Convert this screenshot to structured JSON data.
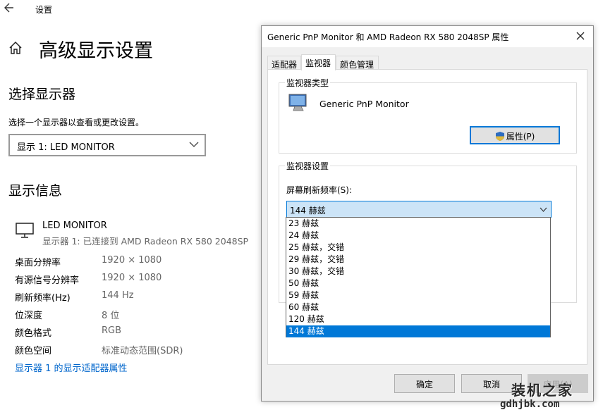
{
  "settings": {
    "app_title": "设置",
    "back_icon": "arrow-left-icon",
    "home_icon": "home-icon",
    "page_title": "高级显示设置",
    "select_section_title": "选择显示器",
    "select_description": "选择一个显示器以查看或更改设置。",
    "display_dropdown_value": "显示 1: LED MONITOR",
    "info_section_title": "显示信息",
    "monitor_name": "LED MONITOR",
    "monitor_connection": "显示器 1: 已连接到 AMD Radeon RX 580 2048SP",
    "info_rows": [
      {
        "label": "桌面分辨率",
        "value": "1920 × 1080"
      },
      {
        "label": "有源信号分辨率",
        "value": "1920 × 1080"
      },
      {
        "label": "刷新频率(Hz)",
        "value": "144 Hz"
      },
      {
        "label": "位深度",
        "value": "8 位"
      },
      {
        "label": "颜色格式",
        "value": "RGB"
      },
      {
        "label": "颜色空间",
        "value": "标准动态范围(SDR)"
      }
    ],
    "adapter_link": "显示器 1 的显示适配器属性"
  },
  "dialog": {
    "title": "Generic PnP Monitor 和 AMD Radeon RX 580 2048SP 属性",
    "tabs": [
      {
        "label": "适配器",
        "active": false
      },
      {
        "label": "监视器",
        "active": true
      },
      {
        "label": "颜色管理",
        "active": false
      }
    ],
    "monitor_type_group": "监视器类型",
    "monitor_type_name": "Generic PnP Monitor",
    "properties_button": "属性(P)",
    "monitor_settings_group": "监视器设置",
    "refresh_label": "屏幕刷新频率(S):",
    "refresh_selected": "144 赫兹",
    "refresh_options": [
      "23 赫兹",
      "24 赫兹",
      "25 赫兹，交错",
      "29 赫兹，交错",
      "30 赫兹，交错",
      "50 赫兹",
      "59 赫兹",
      "60 赫兹",
      "120 赫兹",
      "144 赫兹"
    ],
    "ok_button": "确定",
    "cancel_button": "取消",
    "apply_button": "应用(A)"
  },
  "watermark": {
    "brand": "装机之家",
    "url": "gdhjbk.com"
  },
  "colors": {
    "accent": "#0078d7",
    "link": "#0066cc",
    "selection_bg": "#0078d7",
    "dropdown_bg": "#cce4f7"
  }
}
